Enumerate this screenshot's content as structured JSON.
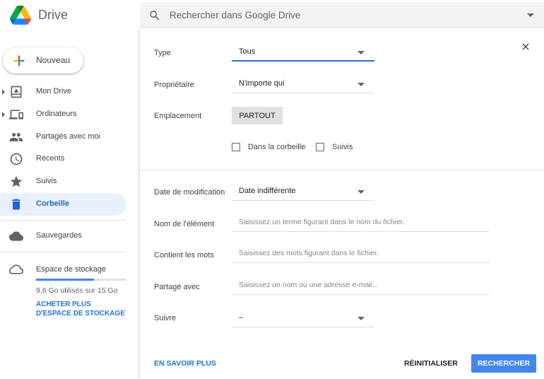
{
  "app": {
    "name": "Drive"
  },
  "search": {
    "placeholder": "Rechercher dans Google Drive"
  },
  "sidebar": {
    "new_label": "Nouveau",
    "items": [
      {
        "label": "Mon Drive",
        "icon": "my-drive-icon",
        "expandable": true
      },
      {
        "label": "Ordinateurs",
        "icon": "computers-icon",
        "expandable": true
      },
      {
        "label": "Partagés avec moi",
        "icon": "shared-people-icon"
      },
      {
        "label": "Récents",
        "icon": "clock-icon"
      },
      {
        "label": "Suivis",
        "icon": "star-icon"
      },
      {
        "label": "Corbeille",
        "icon": "trash-icon",
        "active": true
      }
    ],
    "backups": {
      "label": "Sauvegardes",
      "icon": "cloud-icon"
    },
    "storage": {
      "title": "Espace de stockage",
      "used_text": "9,6 Go utilisés sur 15 Go",
      "used_fraction": 0.64,
      "buy_link": "ACHETER PLUS D'ESPACE DE STOCKAGE"
    }
  },
  "panel": {
    "type": {
      "label": "Type",
      "value": "Tous"
    },
    "owner": {
      "label": "Propriétaire",
      "value": "N'importe qui"
    },
    "location": {
      "label": "Emplacement",
      "chip": "PARTOUT"
    },
    "checkboxes": [
      {
        "label": "Dans la corbeille",
        "checked": false
      },
      {
        "label": "Suivis",
        "checked": false
      }
    ],
    "modified": {
      "label": "Date de modification",
      "value": "Date indifférente"
    },
    "item_name": {
      "label": "Nom de l'élément",
      "placeholder": "Saisissez un terme figurant dans le nom du fichier."
    },
    "has_words": {
      "label": "Contient les mots",
      "placeholder": "Saisissez des mots figurant dans le fichier."
    },
    "shared_with": {
      "label": "Partagé avec",
      "placeholder": "Saisissez un nom ou une adresse e-mail..."
    },
    "follow_up": {
      "label": "Suivre",
      "value": "–"
    },
    "learn_more": "EN SAVOIR PLUS",
    "reset": "RÉINITIALISER",
    "search": "RECHERCHER"
  },
  "colors": {
    "accent": "#1a73e8",
    "primary_button": "#4285f4",
    "active_bg": "#e8f0fe"
  }
}
